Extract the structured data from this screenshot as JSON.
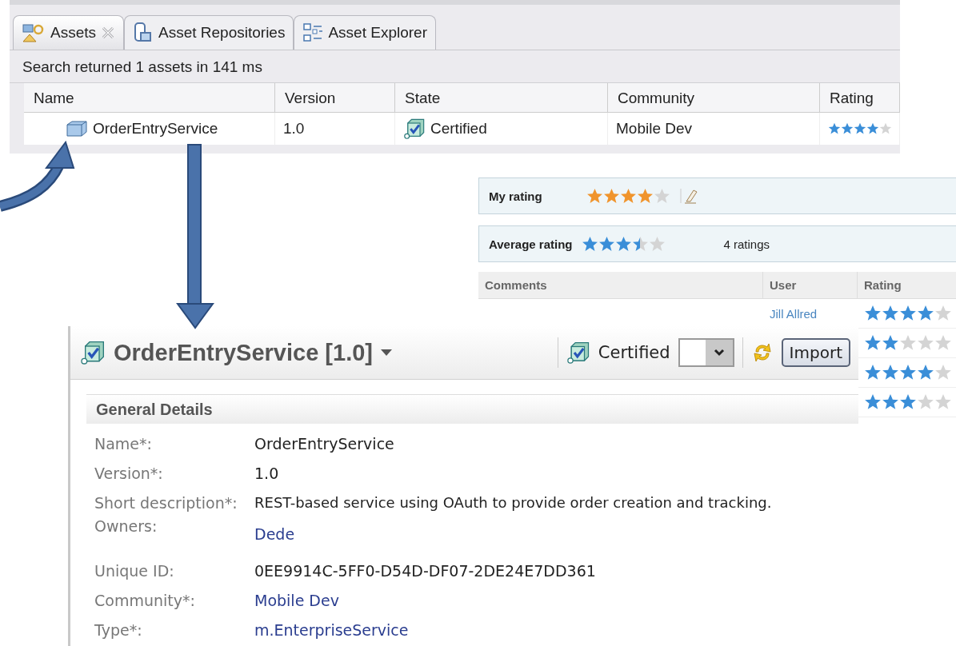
{
  "tabs": [
    {
      "label": "Assets",
      "selected": true,
      "closable": true,
      "kind": "assets"
    },
    {
      "label": "Asset Repositories",
      "selected": false,
      "closable": false,
      "kind": "repositories"
    },
    {
      "label": "Asset Explorer",
      "selected": false,
      "closable": false,
      "kind": "explorer"
    }
  ],
  "search_status": "Search returned 1 assets in 141 ms",
  "assets_table": {
    "columns": [
      "Name",
      "Version",
      "State",
      "Community",
      "Rating"
    ],
    "rows": [
      {
        "name": "OrderEntryService",
        "version": "1.0",
        "state": "Certified",
        "community": "Mobile Dev",
        "stars": 4
      }
    ]
  },
  "rating_panel": {
    "my_rating": {
      "label": "My rating",
      "stars": 4
    },
    "average_rating": {
      "label": "Average rating",
      "stars": 3.5,
      "count": "4 ratings"
    },
    "comments": {
      "columns": [
        "Comments",
        "User",
        "Rating"
      ],
      "rows": [
        {
          "user": "Jill Allred",
          "stars": 4
        },
        {
          "stars": 2
        },
        {
          "stars": 4
        },
        {
          "stars": 3
        }
      ]
    }
  },
  "asset_details": {
    "title": "OrderEntryService [1.0]",
    "state": "Certified",
    "import_button": "Import",
    "section": "General Details",
    "fields": [
      {
        "label": "Name*:",
        "value": "OrderEntryService",
        "kind": "text"
      },
      {
        "label": "Version*:",
        "value": "1.0",
        "kind": "text"
      },
      {
        "label": "Short description*:",
        "value": "REST-based service using OAuth to provide order creation and tracking.",
        "kind": "text"
      },
      {
        "label": "Owners:",
        "value": "Dede",
        "kind": "link"
      },
      {
        "label": "Unique ID:",
        "value": "0EE9914C-5FF0-D54D-DF07-2DE24E7DD361",
        "kind": "text"
      },
      {
        "label": "Community*:",
        "value": "Mobile Dev",
        "kind": "link"
      },
      {
        "label": "Type*:",
        "value": "m.EnterpriseService",
        "kind": "link"
      }
    ]
  }
}
